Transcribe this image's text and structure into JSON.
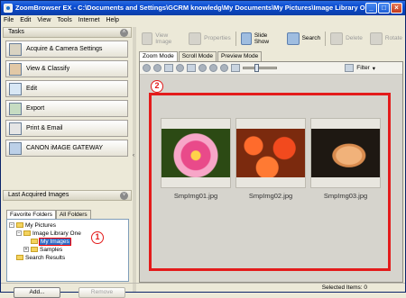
{
  "window": {
    "title": "ZoomBrowser EX  -  C:\\Documents and Settings\\GCRM knowledg\\My Documents\\My Pictures\\Image Library On..."
  },
  "menu": [
    "File",
    "Edit",
    "View",
    "Tools",
    "Internet",
    "Help"
  ],
  "tasks": {
    "header": "Tasks",
    "items": [
      "Acquire & Camera Settings",
      "View & Classify",
      "Edit",
      "Export",
      "Print & Email",
      "CANON iMAGE GATEWAY"
    ]
  },
  "acquired": {
    "header": "Last Acquired Images",
    "tabs": [
      "Favorite Folders",
      "All Folders"
    ],
    "tree": [
      {
        "label": "My Pictures",
        "level": 0
      },
      {
        "label": "Image Library One",
        "level": 1
      },
      {
        "label": "My Images",
        "level": 2,
        "selected": true
      },
      {
        "label": "Samples",
        "level": 2
      },
      {
        "label": "Search Results",
        "level": 0
      }
    ],
    "add_label": "Add...",
    "remove_label": "Remove"
  },
  "toolbar": {
    "view_image": "View Image",
    "properties": "Properties",
    "slide_show": "Slide Show",
    "search": "Search",
    "delete": "Delete",
    "rotate": "Rotate"
  },
  "view_tabs": [
    "Zoom Mode",
    "Scroll Mode",
    "Preview Mode"
  ],
  "filter_label": "Filter",
  "thumbnails": [
    {
      "file": "SmpImg01.jpg"
    },
    {
      "file": "SmpImg02.jpg"
    },
    {
      "file": "SmpImg03.jpg"
    }
  ],
  "callouts": [
    "1",
    "2"
  ],
  "status": {
    "selected": "Selected Items: 0"
  },
  "colors": {
    "accent": "#e31b1b",
    "titlebar": "#0a4bd0"
  }
}
